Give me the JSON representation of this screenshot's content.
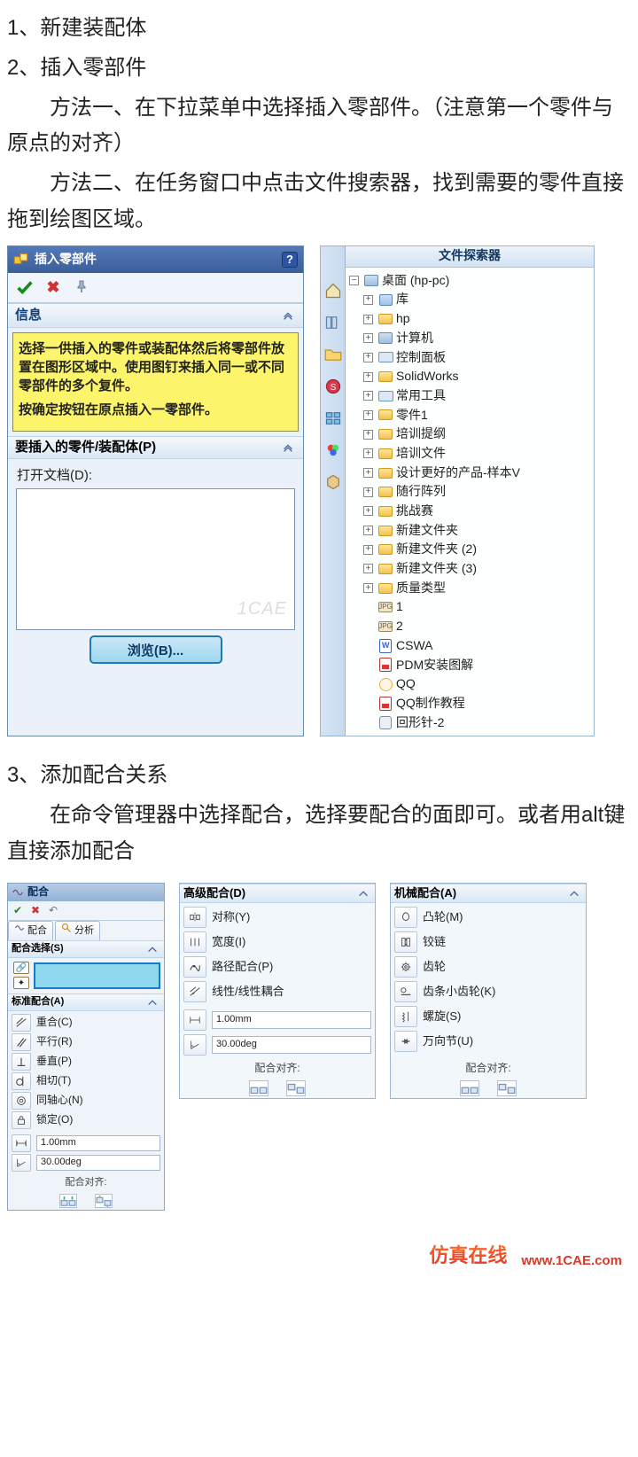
{
  "steps": {
    "s1": "1、新建装配体",
    "s2": "2、插入零部件",
    "m1": "方法一、在下拉菜单中选择插入零部件。（注意第一个零件与原点的对齐）",
    "m2": "方法二、在任务窗口中点击文件搜索器，找到需要的零件直接拖到绘图区域。",
    "s3": "3、添加配合关系",
    "s3d": "在命令管理器中选择配合，选择要配合的面即可。或者用alt键直接添加配合"
  },
  "insert_panel": {
    "title": "插入零部件",
    "help": "?",
    "info_head": "信息",
    "info_p1": "选择一供插入的零件或装配体然后将零部件放置在图形区域中。使用图钉来插入同一或不同零部件的多个复件。",
    "info_p2": "按确定按钮在原点插入一零部件。",
    "sel_head": "要插入的零件/装配体(P)",
    "open_label": "打开文档(D):",
    "watermark": "1CAE",
    "browse": "浏览(B)..."
  },
  "file_explorer": {
    "title": "文件探索器",
    "root": "桌面 (hp-pc)",
    "items": [
      {
        "t": "库",
        "ic": "lib",
        "lvl": 1,
        "exp": "+"
      },
      {
        "t": "hp",
        "ic": "folder",
        "lvl": 1,
        "exp": "+"
      },
      {
        "t": "计算机",
        "ic": "pc",
        "lvl": 1,
        "exp": "+"
      },
      {
        "t": "控制面板",
        "ic": "cp",
        "lvl": 1,
        "exp": "+"
      },
      {
        "t": "SolidWorks",
        "ic": "folder",
        "lvl": 1,
        "exp": "+"
      },
      {
        "t": "常用工具",
        "ic": "cp",
        "lvl": 1,
        "exp": "+"
      },
      {
        "t": "零件1",
        "ic": "folder",
        "lvl": 1,
        "exp": "+"
      },
      {
        "t": "培训提纲",
        "ic": "folder",
        "lvl": 1,
        "exp": "+"
      },
      {
        "t": "培训文件",
        "ic": "folder",
        "lvl": 1,
        "exp": "+"
      },
      {
        "t": "设计更好的产品-样本V",
        "ic": "folder",
        "lvl": 1,
        "exp": "+"
      },
      {
        "t": "随行阵列",
        "ic": "folder",
        "lvl": 1,
        "exp": "+"
      },
      {
        "t": "挑战赛",
        "ic": "folder",
        "lvl": 1,
        "exp": "+"
      },
      {
        "t": "新建文件夹",
        "ic": "folder",
        "lvl": 1,
        "exp": "+"
      },
      {
        "t": "新建文件夹 (2)",
        "ic": "folder",
        "lvl": 1,
        "exp": "+"
      },
      {
        "t": "新建文件夹 (3)",
        "ic": "folder",
        "lvl": 1,
        "exp": "+"
      },
      {
        "t": "质量类型",
        "ic": "folder",
        "lvl": 1,
        "exp": "+"
      },
      {
        "t": "1",
        "ic": "img",
        "lvl": 1,
        "exp": ""
      },
      {
        "t": "2",
        "ic": "img",
        "lvl": 1,
        "exp": ""
      },
      {
        "t": "CSWA",
        "ic": "doc",
        "lvl": 1,
        "exp": ""
      },
      {
        "t": "PDM安装图解",
        "ic": "pdf",
        "lvl": 1,
        "exp": ""
      },
      {
        "t": "QQ",
        "ic": "qq",
        "lvl": 1,
        "exp": ""
      },
      {
        "t": "QQ制作教程",
        "ic": "pdf",
        "lvl": 1,
        "exp": ""
      },
      {
        "t": "回形针-2",
        "ic": "clip",
        "lvl": 1,
        "exp": ""
      }
    ]
  },
  "mate_panel": {
    "title": "配合",
    "tab1": "配合",
    "tab2": "分析",
    "sel_head": "配合选择(S)",
    "std_head": "标准配合(A)",
    "options": [
      {
        "l": "重合(C)",
        "ic": "coincident"
      },
      {
        "l": "平行(R)",
        "ic": "parallel"
      },
      {
        "l": "垂直(P)",
        "ic": "perpendicular"
      },
      {
        "l": "相切(T)",
        "ic": "tangent"
      },
      {
        "l": "同轴心(N)",
        "ic": "concentric"
      },
      {
        "l": "锁定(O)",
        "ic": "lock"
      }
    ],
    "dist": "1.00mm",
    "ang": "30.00deg",
    "align": "配合对齐:"
  },
  "adv_panel": {
    "head": "高级配合(D)",
    "options": [
      {
        "l": "对称(Y)",
        "ic": "symmetric"
      },
      {
        "l": "宽度(I)",
        "ic": "width"
      },
      {
        "l": "路径配合(P)",
        "ic": "path"
      },
      {
        "l": "线性/线性耦合",
        "ic": "linear"
      }
    ],
    "dist": "1.00mm",
    "ang": "30.00deg",
    "align": "配合对齐:"
  },
  "mech_panel": {
    "head": "机械配合(A)",
    "options": [
      {
        "l": "凸轮(M)",
        "ic": "cam"
      },
      {
        "l": "铰链",
        "ic": "hinge"
      },
      {
        "l": "齿轮",
        "ic": "gear"
      },
      {
        "l": "齿条小齿轮(K)",
        "ic": "rack"
      },
      {
        "l": "螺旋(S)",
        "ic": "screw"
      },
      {
        "l": "万向节(U)",
        "ic": "universal"
      }
    ],
    "align": "配合对齐:"
  },
  "footer": {
    "t1": "仿真在线",
    "t2": "www.1CAE.com"
  }
}
